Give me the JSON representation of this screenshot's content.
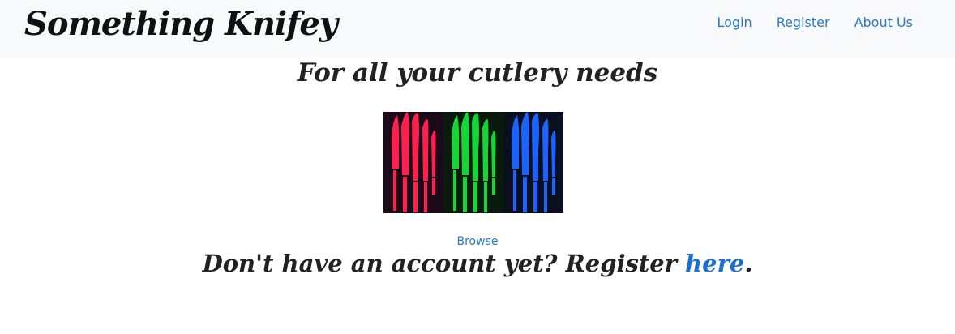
{
  "navbar": {
    "brand": "Something Knifey",
    "links": [
      "Login",
      "Register",
      "About Us"
    ]
  },
  "main": {
    "tagline": "For all your cutlery needs",
    "hero_image": "knife-collage-image",
    "browse_link": "Browse",
    "register_prompt": "Don't have an account yet? Register ",
    "register_link": "here",
    "register_suffix": "."
  },
  "colors": {
    "navbar_bg": "#f8f9fa",
    "link": "#2a7ac5",
    "text": "#222222",
    "knife_red": "#ff1f4f",
    "knife_green": "#14d636",
    "knife_blue": "#1b63ff"
  }
}
